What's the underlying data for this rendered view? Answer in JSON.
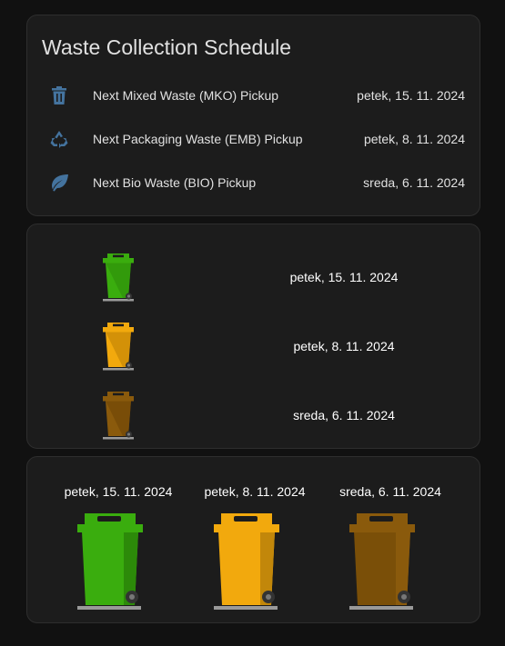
{
  "schedule": {
    "title": "Waste Collection Schedule",
    "items": [
      {
        "icon": "trash-can-icon",
        "label": "Next Mixed Waste (MKO) Pickup",
        "date": "petek, 15. 11. 2024"
      },
      {
        "icon": "recycle-icon",
        "label": "Next Packaging Waste (EMB) Pickup",
        "date": "petek, 8. 11. 2024"
      },
      {
        "icon": "leaf-icon",
        "label": "Next Bio Waste (BIO) Pickup",
        "date": "sreda, 6. 11. 2024"
      }
    ]
  },
  "bins_list": [
    {
      "color": "green",
      "date": "petek, 15. 11. 2024"
    },
    {
      "color": "yellow",
      "date": "petek, 8. 11. 2024"
    },
    {
      "color": "brown",
      "date": "sreda, 6. 11. 2024"
    }
  ],
  "bins_grid": [
    {
      "color": "green",
      "date": "petek, 15. 11. 2024"
    },
    {
      "color": "yellow",
      "date": "petek, 8. 11. 2024"
    },
    {
      "color": "brown",
      "date": "sreda, 6. 11. 2024"
    }
  ],
  "colors": {
    "icon": "#44739e",
    "green": "#3aad0e",
    "yellow": "#f2a90d",
    "brown": "#8a5a0c"
  }
}
